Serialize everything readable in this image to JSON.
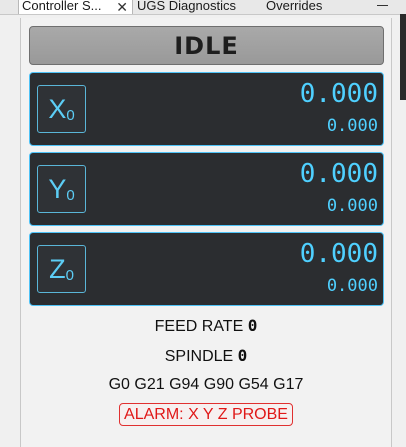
{
  "tabs": [
    {
      "label": "Controller S...",
      "active": true,
      "closable": true
    },
    {
      "label": "UGS Diagnostics",
      "active": false
    },
    {
      "label": "Overrides",
      "active": false
    }
  ],
  "window": {
    "minimize_icon": "minimize-icon"
  },
  "controller": {
    "state": "IDLE",
    "axes": [
      {
        "letter": "X",
        "sub": "0",
        "work": "0.000",
        "machine": "0.000"
      },
      {
        "letter": "Y",
        "sub": "0",
        "work": "0.000",
        "machine": "0.000"
      },
      {
        "letter": "Z",
        "sub": "0",
        "work": "0.000",
        "machine": "0.000"
      }
    ],
    "feed_label": "FEED RATE",
    "feed_value": "0",
    "spindle_label": "SPINDLE",
    "spindle_value": "0",
    "gcode_state": "G0 G21 G94 G90 G54 G17",
    "alarm": "ALARM: X Y Z PROBE"
  },
  "colors": {
    "accent": "#4fd0ff",
    "dro_background": "#2b2d30",
    "state_bar": "#a3a3a3",
    "alarm": "#e01818",
    "active_tab_indicator": "#3c7fd0"
  }
}
